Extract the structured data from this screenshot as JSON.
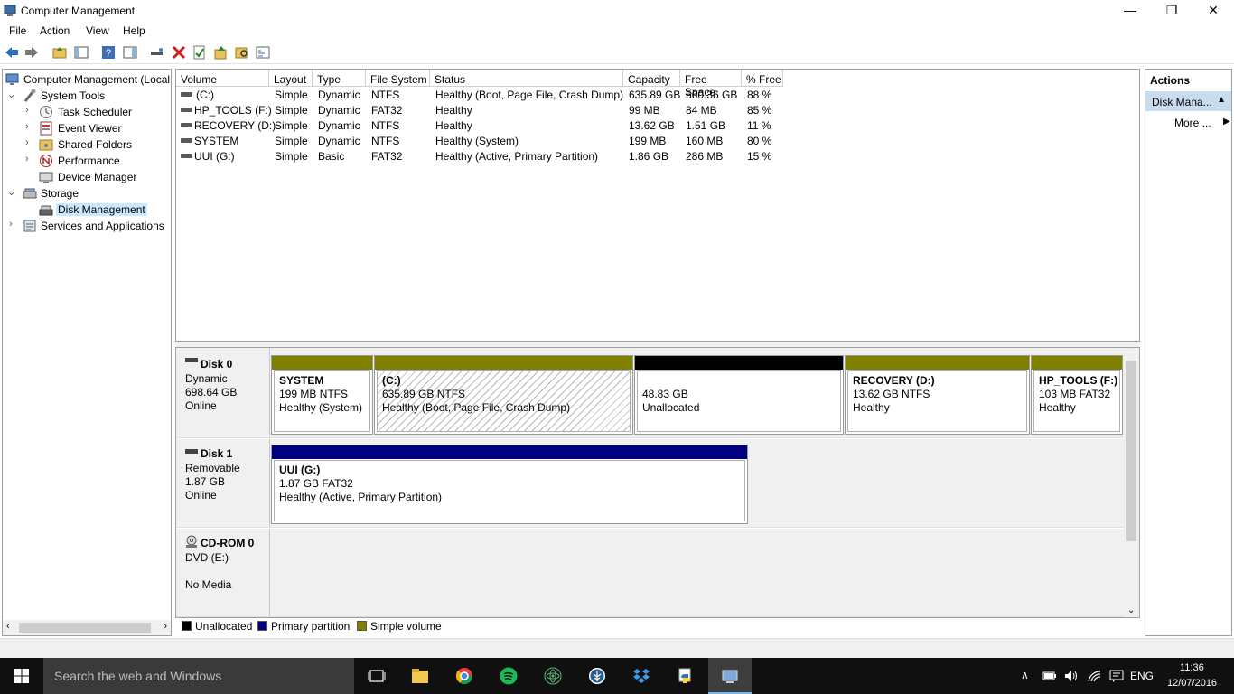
{
  "window": {
    "title": "Computer Management"
  },
  "menu": [
    "File",
    "Action",
    "View",
    "Help"
  ],
  "tree": {
    "root": "Computer Management (Local",
    "system_tools": "System Tools",
    "task_scheduler": "Task Scheduler",
    "event_viewer": "Event Viewer",
    "shared_folders": "Shared Folders",
    "performance": "Performance",
    "device_manager": "Device Manager",
    "storage": "Storage",
    "disk_management": "Disk Management",
    "services": "Services and Applications"
  },
  "volume_list": {
    "columns": [
      "Volume",
      "Layout",
      "Type",
      "File System",
      "Status",
      "Capacity",
      "Free Space",
      "% Free"
    ],
    "rows": [
      [
        "(C:)",
        "Simple",
        "Dynamic",
        "NTFS",
        "Healthy (Boot, Page File, Crash Dump)",
        "635.89 GB",
        "560.36 GB",
        "88 %"
      ],
      [
        "HP_TOOLS (F:)",
        "Simple",
        "Dynamic",
        "FAT32",
        "Healthy",
        "99 MB",
        "84 MB",
        "85 %"
      ],
      [
        "RECOVERY (D:)",
        "Simple",
        "Dynamic",
        "NTFS",
        "Healthy",
        "13.62 GB",
        "1.51 GB",
        "11 %"
      ],
      [
        "SYSTEM",
        "Simple",
        "Dynamic",
        "NTFS",
        "Healthy (System)",
        "199 MB",
        "160 MB",
        "80 %"
      ],
      [
        "UUI (G:)",
        "Simple",
        "Basic",
        "FAT32",
        "Healthy (Active, Primary Partition)",
        "1.86 GB",
        "286 MB",
        "15 %"
      ]
    ]
  },
  "disks": {
    "disk0": {
      "name": "Disk 0",
      "type": "Dynamic",
      "size": "698.64 GB",
      "status": "Online",
      "partitions": {
        "system": {
          "name": "SYSTEM",
          "size": "199 MB NTFS",
          "status": "Healthy (System)"
        },
        "c": {
          "name": "(C:)",
          "size": "635.89 GB NTFS",
          "status": "Healthy (Boot, Page File, Crash Dump)"
        },
        "unalloc": {
          "size": "48.83 GB",
          "status": "Unallocated"
        },
        "recovery": {
          "name": "RECOVERY  (D:)",
          "size": "13.62 GB NTFS",
          "status": "Healthy"
        },
        "hptools": {
          "name": "HP_TOOLS  (F:)",
          "size": "103 MB FAT32",
          "status": "Healthy"
        }
      }
    },
    "disk1": {
      "name": "Disk 1",
      "type": "Removable",
      "size": "1.87 GB",
      "status": "Online",
      "partitions": {
        "uui": {
          "name": "UUI  (G:)",
          "size": "1.87 GB FAT32",
          "status": "Healthy (Active, Primary Partition)"
        }
      }
    },
    "cdrom": {
      "name": "CD-ROM 0",
      "type": "DVD (E:)",
      "status": "No Media"
    }
  },
  "legend": [
    "Unallocated",
    "Primary partition",
    "Simple volume"
  ],
  "colors": {
    "unallocated": "#000000",
    "primary": "#000080",
    "simple": "#808000",
    "selection": "#cce8ff"
  },
  "actions": {
    "header": "Actions",
    "section": "Disk Mana...",
    "more": "More ..."
  },
  "taskbar": {
    "search_placeholder": "Search the web and Windows",
    "lang": "ENG",
    "time": "11:36",
    "date": "12/07/2016"
  }
}
